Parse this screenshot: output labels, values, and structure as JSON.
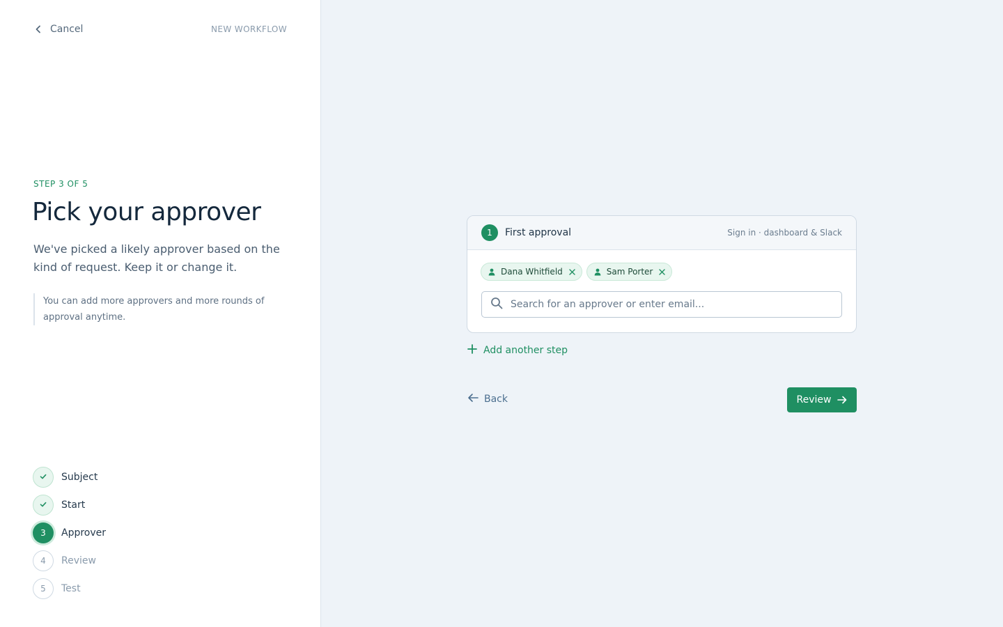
{
  "header": {
    "cancel_label": "Cancel",
    "section_label": "NEW WORKFLOW"
  },
  "intro": {
    "step_counter": "STEP 3 OF 5",
    "title": "Pick your approver",
    "description": "We've picked a likely approver based on the kind of request. Keep it or change it.",
    "note": "You can add more approvers and more rounds of approval anytime."
  },
  "steps": [
    {
      "marker": "check-icon",
      "label": "Subject",
      "status": "done"
    },
    {
      "marker": "check-icon",
      "label": "Start",
      "status": "done"
    },
    {
      "marker": "3",
      "label": "Approver",
      "status": "current"
    },
    {
      "marker": "4",
      "label": "Review",
      "status": "todo"
    },
    {
      "marker": "5",
      "label": "Test",
      "status": "todo"
    }
  ],
  "approval_card": {
    "number": "1",
    "title": "First approval",
    "meta": "Sign in · dashboard & Slack",
    "approvers": [
      {
        "name": "Dana Whitfield",
        "icon": "user-icon"
      },
      {
        "name": "Sam Porter",
        "icon": "user-icon"
      }
    ],
    "search": {
      "value": "",
      "placeholder": "Search for an approver or enter email..."
    }
  },
  "actions": {
    "add_step_label": "Add another step",
    "back_label": "Back",
    "review_label": "Review"
  },
  "colors": {
    "accent": "#1f8f62",
    "accent_light": "#e8f6ef",
    "panel_bg": "#eef3f8",
    "text_dark": "#14283c",
    "text_muted": "#8a9bac"
  }
}
